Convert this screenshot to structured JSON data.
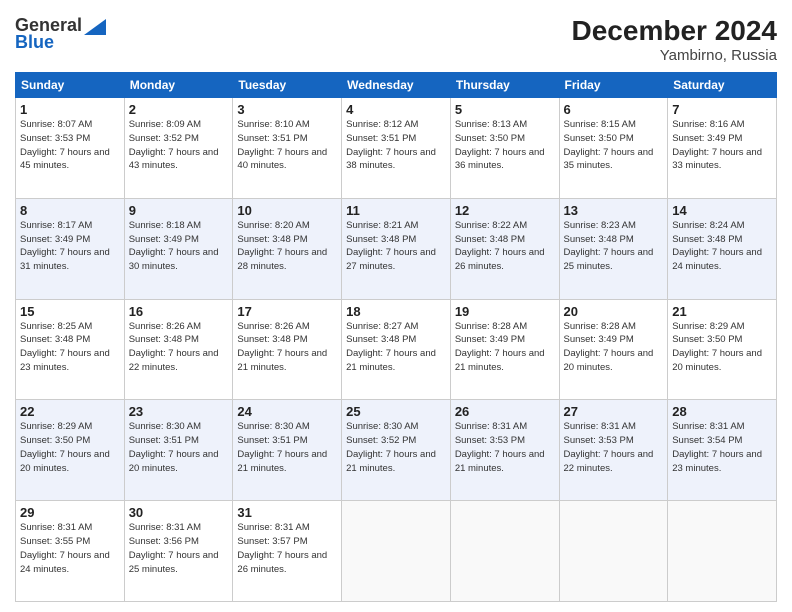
{
  "header": {
    "logo_line1": "General",
    "logo_line2": "Blue",
    "title": "December 2024",
    "subtitle": "Yambirno, Russia"
  },
  "days_of_week": [
    "Sunday",
    "Monday",
    "Tuesday",
    "Wednesday",
    "Thursday",
    "Friday",
    "Saturday"
  ],
  "weeks": [
    [
      {
        "day": "1",
        "sunrise": "Sunrise: 8:07 AM",
        "sunset": "Sunset: 3:53 PM",
        "daylight": "Daylight: 7 hours and 45 minutes."
      },
      {
        "day": "2",
        "sunrise": "Sunrise: 8:09 AM",
        "sunset": "Sunset: 3:52 PM",
        "daylight": "Daylight: 7 hours and 43 minutes."
      },
      {
        "day": "3",
        "sunrise": "Sunrise: 8:10 AM",
        "sunset": "Sunset: 3:51 PM",
        "daylight": "Daylight: 7 hours and 40 minutes."
      },
      {
        "day": "4",
        "sunrise": "Sunrise: 8:12 AM",
        "sunset": "Sunset: 3:51 PM",
        "daylight": "Daylight: 7 hours and 38 minutes."
      },
      {
        "day": "5",
        "sunrise": "Sunrise: 8:13 AM",
        "sunset": "Sunset: 3:50 PM",
        "daylight": "Daylight: 7 hours and 36 minutes."
      },
      {
        "day": "6",
        "sunrise": "Sunrise: 8:15 AM",
        "sunset": "Sunset: 3:50 PM",
        "daylight": "Daylight: 7 hours and 35 minutes."
      },
      {
        "day": "7",
        "sunrise": "Sunrise: 8:16 AM",
        "sunset": "Sunset: 3:49 PM",
        "daylight": "Daylight: 7 hours and 33 minutes."
      }
    ],
    [
      {
        "day": "8",
        "sunrise": "Sunrise: 8:17 AM",
        "sunset": "Sunset: 3:49 PM",
        "daylight": "Daylight: 7 hours and 31 minutes."
      },
      {
        "day": "9",
        "sunrise": "Sunrise: 8:18 AM",
        "sunset": "Sunset: 3:49 PM",
        "daylight": "Daylight: 7 hours and 30 minutes."
      },
      {
        "day": "10",
        "sunrise": "Sunrise: 8:20 AM",
        "sunset": "Sunset: 3:48 PM",
        "daylight": "Daylight: 7 hours and 28 minutes."
      },
      {
        "day": "11",
        "sunrise": "Sunrise: 8:21 AM",
        "sunset": "Sunset: 3:48 PM",
        "daylight": "Daylight: 7 hours and 27 minutes."
      },
      {
        "day": "12",
        "sunrise": "Sunrise: 8:22 AM",
        "sunset": "Sunset: 3:48 PM",
        "daylight": "Daylight: 7 hours and 26 minutes."
      },
      {
        "day": "13",
        "sunrise": "Sunrise: 8:23 AM",
        "sunset": "Sunset: 3:48 PM",
        "daylight": "Daylight: 7 hours and 25 minutes."
      },
      {
        "day": "14",
        "sunrise": "Sunrise: 8:24 AM",
        "sunset": "Sunset: 3:48 PM",
        "daylight": "Daylight: 7 hours and 24 minutes."
      }
    ],
    [
      {
        "day": "15",
        "sunrise": "Sunrise: 8:25 AM",
        "sunset": "Sunset: 3:48 PM",
        "daylight": "Daylight: 7 hours and 23 minutes."
      },
      {
        "day": "16",
        "sunrise": "Sunrise: 8:26 AM",
        "sunset": "Sunset: 3:48 PM",
        "daylight": "Daylight: 7 hours and 22 minutes."
      },
      {
        "day": "17",
        "sunrise": "Sunrise: 8:26 AM",
        "sunset": "Sunset: 3:48 PM",
        "daylight": "Daylight: 7 hours and 21 minutes."
      },
      {
        "day": "18",
        "sunrise": "Sunrise: 8:27 AM",
        "sunset": "Sunset: 3:48 PM",
        "daylight": "Daylight: 7 hours and 21 minutes."
      },
      {
        "day": "19",
        "sunrise": "Sunrise: 8:28 AM",
        "sunset": "Sunset: 3:49 PM",
        "daylight": "Daylight: 7 hours and 21 minutes."
      },
      {
        "day": "20",
        "sunrise": "Sunrise: 8:28 AM",
        "sunset": "Sunset: 3:49 PM",
        "daylight": "Daylight: 7 hours and 20 minutes."
      },
      {
        "day": "21",
        "sunrise": "Sunrise: 8:29 AM",
        "sunset": "Sunset: 3:50 PM",
        "daylight": "Daylight: 7 hours and 20 minutes."
      }
    ],
    [
      {
        "day": "22",
        "sunrise": "Sunrise: 8:29 AM",
        "sunset": "Sunset: 3:50 PM",
        "daylight": "Daylight: 7 hours and 20 minutes."
      },
      {
        "day": "23",
        "sunrise": "Sunrise: 8:30 AM",
        "sunset": "Sunset: 3:51 PM",
        "daylight": "Daylight: 7 hours and 20 minutes."
      },
      {
        "day": "24",
        "sunrise": "Sunrise: 8:30 AM",
        "sunset": "Sunset: 3:51 PM",
        "daylight": "Daylight: 7 hours and 21 minutes."
      },
      {
        "day": "25",
        "sunrise": "Sunrise: 8:30 AM",
        "sunset": "Sunset: 3:52 PM",
        "daylight": "Daylight: 7 hours and 21 minutes."
      },
      {
        "day": "26",
        "sunrise": "Sunrise: 8:31 AM",
        "sunset": "Sunset: 3:53 PM",
        "daylight": "Daylight: 7 hours and 21 minutes."
      },
      {
        "day": "27",
        "sunrise": "Sunrise: 8:31 AM",
        "sunset": "Sunset: 3:53 PM",
        "daylight": "Daylight: 7 hours and 22 minutes."
      },
      {
        "day": "28",
        "sunrise": "Sunrise: 8:31 AM",
        "sunset": "Sunset: 3:54 PM",
        "daylight": "Daylight: 7 hours and 23 minutes."
      }
    ],
    [
      {
        "day": "29",
        "sunrise": "Sunrise: 8:31 AM",
        "sunset": "Sunset: 3:55 PM",
        "daylight": "Daylight: 7 hours and 24 minutes."
      },
      {
        "day": "30",
        "sunrise": "Sunrise: 8:31 AM",
        "sunset": "Sunset: 3:56 PM",
        "daylight": "Daylight: 7 hours and 25 minutes."
      },
      {
        "day": "31",
        "sunrise": "Sunrise: 8:31 AM",
        "sunset": "Sunset: 3:57 PM",
        "daylight": "Daylight: 7 hours and 26 minutes."
      },
      null,
      null,
      null,
      null
    ]
  ]
}
